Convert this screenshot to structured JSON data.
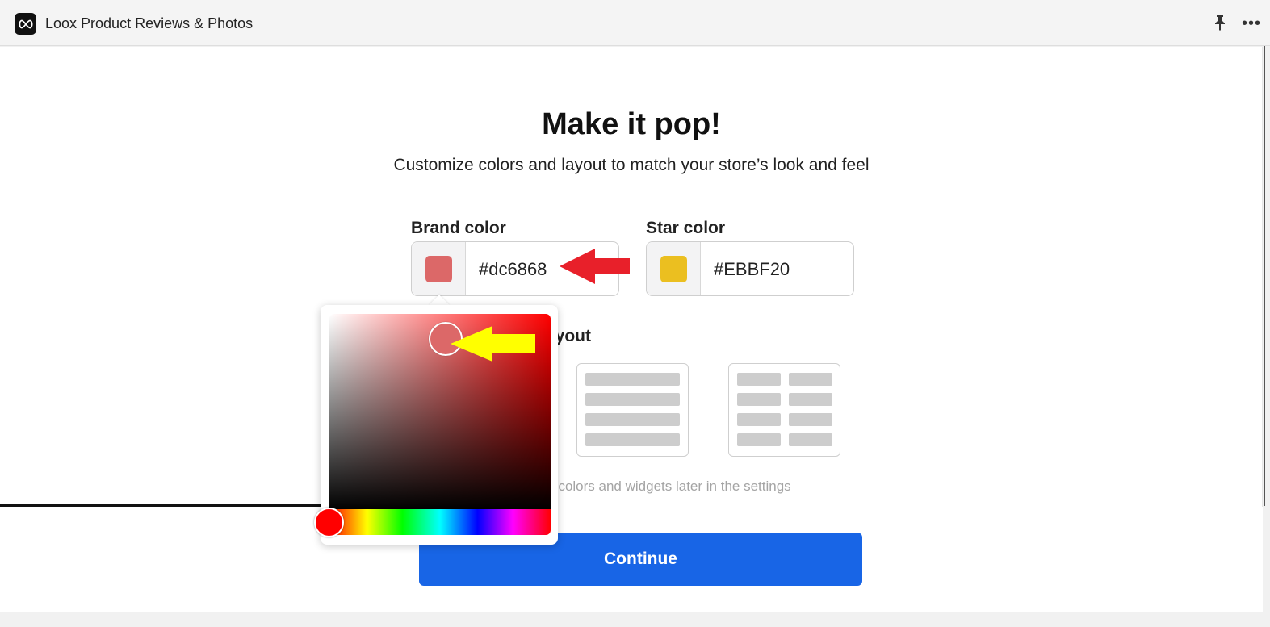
{
  "app": {
    "title": "Loox Product Reviews & Photos",
    "logo_icon": "infinity-icon"
  },
  "toolbar": {
    "pin_icon": "pin-icon",
    "more_label": "•••"
  },
  "page": {
    "title": "Make it pop!",
    "subtitle": "Customize colors and layout to match your store’s look and feel"
  },
  "brand_color": {
    "label": "Brand color",
    "value": "#dc6868",
    "swatch": "#dc6868"
  },
  "star_color": {
    "label": "Star color",
    "value": "#EBBF20",
    "swatch": "#EBBF20"
  },
  "layout": {
    "label_partial": "ayout",
    "options": [
      "list-layout",
      "grid-layout"
    ]
  },
  "hint_text": "ize colors and widgets later in the settings",
  "continue_label": "Continue",
  "color_picker": {
    "hue": "#ff0000",
    "selected": "#dc6868"
  },
  "annotations": {
    "red_arrow": "#e8202a",
    "yellow_arrow": "#ffff00"
  }
}
